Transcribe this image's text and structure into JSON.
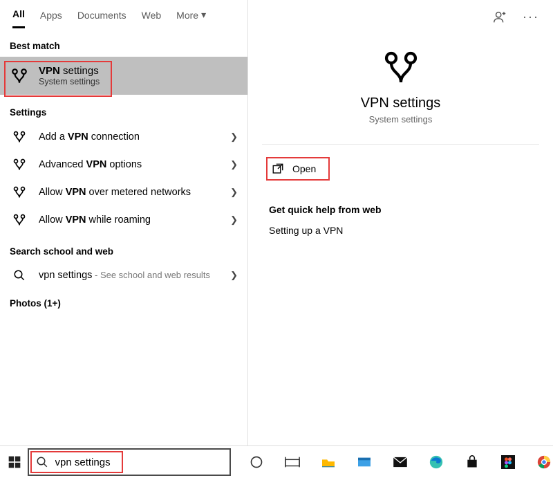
{
  "tabs": {
    "all": "All",
    "apps": "Apps",
    "documents": "Documents",
    "web": "Web",
    "more": "More"
  },
  "sections": {
    "best_match": "Best match",
    "settings": "Settings",
    "school_web": "Search school and web",
    "photos": "Photos (1+)"
  },
  "best_match": {
    "title_prefix": "VPN",
    "title_rest": " settings",
    "subtitle": "System settings"
  },
  "settings_items": [
    {
      "pre": "Add a ",
      "bold": "VPN",
      "post": " connection"
    },
    {
      "pre": "Advanced ",
      "bold": "VPN",
      "post": " options"
    },
    {
      "pre": "Allow ",
      "bold": "VPN",
      "post": " over metered networks"
    },
    {
      "pre": "Allow ",
      "bold": "VPN",
      "post": " while roaming"
    }
  ],
  "web_item": {
    "query": "vpn settings",
    "suffix": " - See school and web results"
  },
  "detail": {
    "title": "VPN settings",
    "subtitle": "System settings",
    "open": "Open",
    "quick_help_header": "Get quick help from web",
    "quick_help_link": "Setting up a VPN"
  },
  "search": {
    "value": "vpn settings"
  }
}
